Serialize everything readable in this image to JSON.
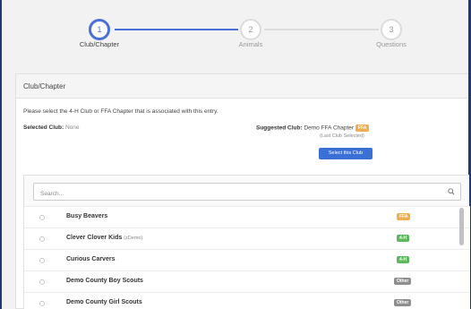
{
  "wizard": {
    "steps": [
      {
        "number": "1",
        "label": "Club/Chapter"
      },
      {
        "number": "2",
        "label": "Animals"
      },
      {
        "number": "3",
        "label": "Questions"
      }
    ]
  },
  "panel": {
    "title": "Club/Chapter",
    "instruction": "Please select the 4-H Club or FFA Chapter that is associated with this entry.",
    "selected_label": "Selected Club:",
    "selected_value": "None",
    "suggested_label": "Suggested Club:",
    "suggested_value": "Demo FFA Chapter",
    "suggested_badge": "FFA",
    "last_selected": "(Last Club Selected)",
    "select_button": "Select this Club"
  },
  "search": {
    "placeholder": "Search..."
  },
  "clubs": [
    {
      "name": "Busy Beavers",
      "sub": "",
      "badge": "FFA"
    },
    {
      "name": "Clever Clover Kids",
      "sub": "(zDemo)",
      "badge": "4-H"
    },
    {
      "name": "Curious Carvers",
      "sub": "",
      "badge": "4-H"
    },
    {
      "name": "Demo County Boy Scouts",
      "sub": "",
      "badge": "Other"
    },
    {
      "name": "Demo County Girl Scouts",
      "sub": "",
      "badge": "Other"
    }
  ],
  "colors": {
    "accent": "#4a6fd6",
    "button": "#3a6fd6",
    "ffa": "#f0ad4e",
    "four_h": "#5cb85c",
    "other": "#8e8e8e"
  }
}
